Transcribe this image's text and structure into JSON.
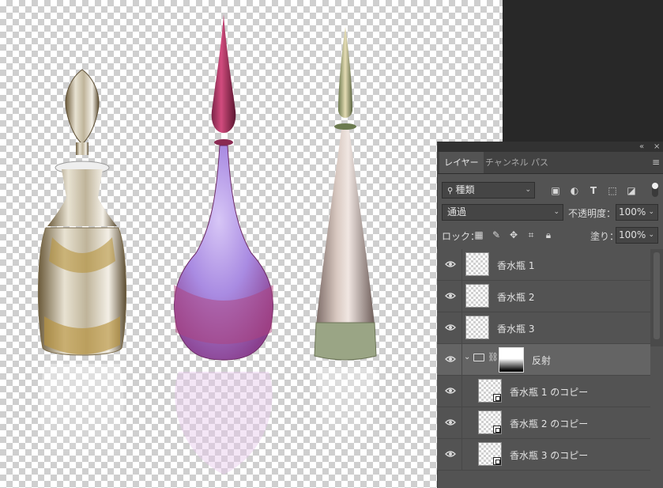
{
  "panel": {
    "collapse_icon": "double-chevron-left-icon",
    "close_icon": "close-icon",
    "tabs": [
      {
        "label": "レイヤー",
        "active": true
      },
      {
        "label": "チャンネル",
        "active": false
      },
      {
        "label": "パス",
        "active": false
      }
    ],
    "filter": {
      "value": "種類",
      "icons": [
        "image-filter-icon",
        "adjustment-filter-icon",
        "type-filter-icon",
        "shape-filter-icon",
        "smart-object-filter-icon"
      ]
    },
    "blend_mode": "通過",
    "opacity_label": "不透明度：",
    "opacity_value": "100%",
    "lock_label": "ロック：",
    "fill_label": "塗り：",
    "fill_value": "100%"
  },
  "layers": [
    {
      "name": "香水瓶 1",
      "type": "layer",
      "visible": true
    },
    {
      "name": "香水瓶 2",
      "type": "layer",
      "visible": true
    },
    {
      "name": "香水瓶 3",
      "type": "layer",
      "visible": true
    },
    {
      "name": "反射",
      "type": "group",
      "visible": true,
      "expanded": true
    },
    {
      "name": "香水瓶 1 のコピー",
      "type": "smart-object",
      "visible": true
    },
    {
      "name": "香水瓶 2 のコピー",
      "type": "smart-object",
      "visible": true
    },
    {
      "name": "香水瓶 3 のコピー",
      "type": "smart-object",
      "visible": true
    }
  ],
  "colors": {
    "panel_bg": "#535353",
    "group_row_bg": "#646464",
    "workspace_bg": "#282828"
  }
}
